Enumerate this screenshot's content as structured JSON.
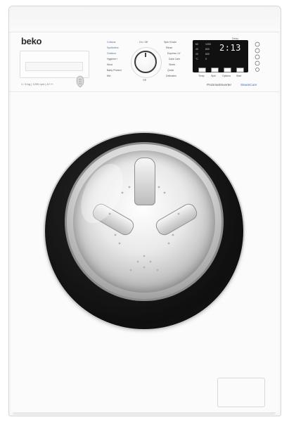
{
  "brand": {
    "logo": "beko"
  },
  "specs": {
    "text": "1 / 8 kg | 1200 rpm | A+++"
  },
  "programs_left": [
    {
      "label": "Cottons"
    },
    {
      "label": "Synthetics"
    },
    {
      "label": "Outdoor"
    },
    {
      "label": "Hygiene+"
    },
    {
      "label": "Wool"
    },
    {
      "label": "Baby Protect"
    },
    {
      "label": "Mix"
    }
  ],
  "programs_right": [
    {
      "label": "Spin+Drain"
    },
    {
      "label": "Rinse"
    },
    {
      "label": "Express 14'"
    },
    {
      "label": "Dark Care"
    },
    {
      "label": "Shirts"
    },
    {
      "label": "Quick"
    },
    {
      "label": "Delicates"
    }
  ],
  "knob": {
    "top_label": "On / Off",
    "bottom_label": "Off"
  },
  "display": {
    "time": "2:13",
    "top_label": "Delay",
    "left_labels": [
      "60",
      "40",
      "20",
      "°C"
    ],
    "right_labels": [
      "1200",
      "800",
      "600",
      "0"
    ]
  },
  "buttons": {
    "labels": [
      "Temp",
      "Spin",
      "Options",
      "Start"
    ]
  },
  "technologies": {
    "inverter": "ProSmartInverter",
    "steam": "SteamCure"
  },
  "colors": {
    "body": "#fbfbfb",
    "door_bezel": "#111111",
    "display": "#111111",
    "accent": "#3a6fb5"
  }
}
